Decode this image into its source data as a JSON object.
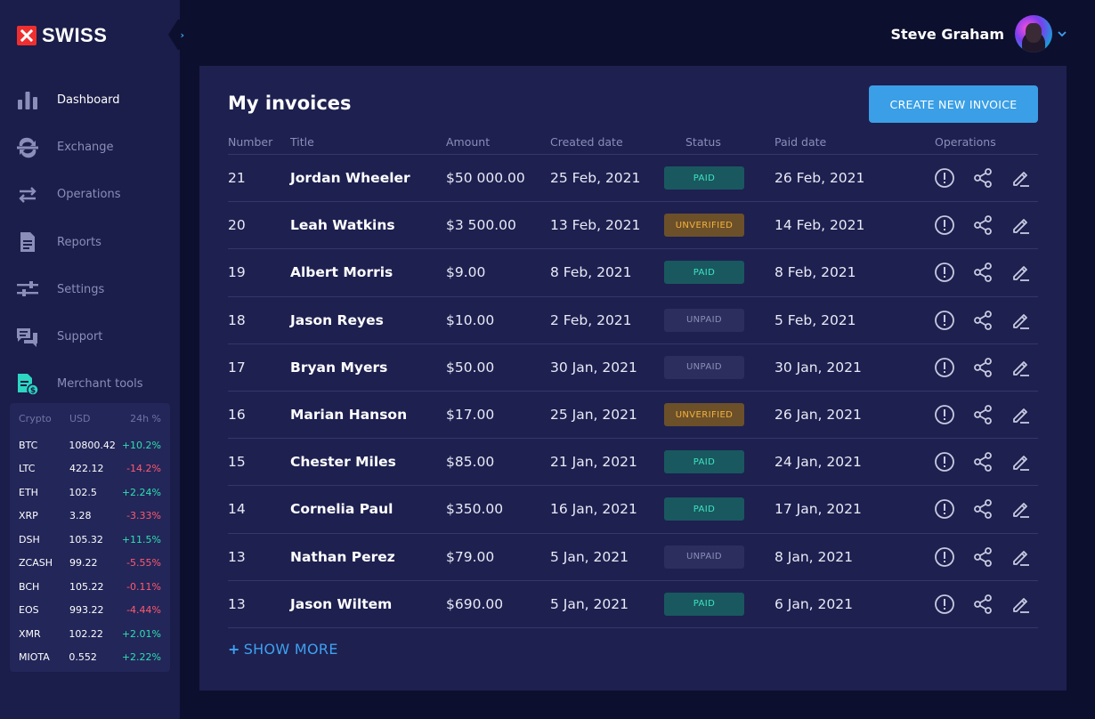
{
  "brand": {
    "name": "SWISS",
    "accent": "#3ea1f0",
    "logo_color": "#ef2f2f"
  },
  "nav": [
    {
      "label": "Dashboard",
      "icon": "bar-chart-icon",
      "active": true
    },
    {
      "label": "Exchange",
      "icon": "exchange-icon",
      "active": false
    },
    {
      "label": "Operations",
      "icon": "transfer-arrows-icon",
      "active": false
    },
    {
      "label": "Reports",
      "icon": "document-icon",
      "active": false
    },
    {
      "label": "Settings",
      "icon": "sliders-icon",
      "active": false
    },
    {
      "label": "Support",
      "icon": "chat-icon",
      "active": false
    },
    {
      "label": "Merchant tools",
      "icon": "merchant-document-icon",
      "active": false
    }
  ],
  "crypto": {
    "headers": [
      "Crypto",
      "USD",
      "24h %"
    ],
    "rows": [
      {
        "symbol": "BTC",
        "usd": "10800.42",
        "change": "+10.2%"
      },
      {
        "symbol": "LTC",
        "usd": "422.12",
        "change": "-14.2%"
      },
      {
        "symbol": "ETH",
        "usd": "102.5",
        "change": "+2.24%"
      },
      {
        "symbol": "XRP",
        "usd": "3.28",
        "change": "-3.33%"
      },
      {
        "symbol": "DSH",
        "usd": "105.32",
        "change": "+11.5%"
      },
      {
        "symbol": "ZCASH",
        "usd": "99.22",
        "change": "-5.55%"
      },
      {
        "symbol": "BCH",
        "usd": "105.22",
        "change": "-0.11%"
      },
      {
        "symbol": "EOS",
        "usd": "993.22",
        "change": "-4.44%"
      },
      {
        "symbol": "XMR",
        "usd": "102.22",
        "change": "+2.01%"
      },
      {
        "symbol": "MIOTA",
        "usd": "0.552",
        "change": "+2.22%"
      }
    ]
  },
  "header": {
    "user_name": "Steve Graham"
  },
  "invoices": {
    "title": "My invoices",
    "create_label": "CREATE NEW INVOICE",
    "columns": [
      "Number",
      "Title",
      "Amount",
      "Created date",
      "Status",
      "Paid date",
      "Operations"
    ],
    "rows": [
      {
        "number": "21",
        "title": "Jordan Wheeler",
        "amount": "$50 000.00",
        "created": "25 Feb, 2021",
        "status": "PAID",
        "paid": "26 Feb, 2021"
      },
      {
        "number": "20",
        "title": "Leah Watkins",
        "amount": "$3 500.00",
        "created": "13 Feb, 2021",
        "status": "UNVERIFIED",
        "paid": "14 Feb, 2021"
      },
      {
        "number": "19",
        "title": "Albert Morris",
        "amount": "$9.00",
        "created": "8 Feb, 2021",
        "status": "PAID",
        "paid": "8 Feb, 2021"
      },
      {
        "number": "18",
        "title": "Jason Reyes",
        "amount": "$10.00",
        "created": "2 Feb, 2021",
        "status": "UNPAID",
        "paid": "5 Feb, 2021"
      },
      {
        "number": "17",
        "title": "Bryan Myers",
        "amount": "$50.00",
        "created": "30 Jan, 2021",
        "status": "UNPAID",
        "paid": "30 Jan, 2021"
      },
      {
        "number": "16",
        "title": "Marian Hanson",
        "amount": "$17.00",
        "created": "25 Jan, 2021",
        "status": "UNVERIFIED",
        "paid": "26 Jan, 2021"
      },
      {
        "number": "15",
        "title": "Chester Miles",
        "amount": "$85.00",
        "created": "21 Jan, 2021",
        "status": "PAID",
        "paid": "24 Jan, 2021"
      },
      {
        "number": "14",
        "title": "Cornelia Paul",
        "amount": "$350.00",
        "created": "16 Jan, 2021",
        "status": "PAID",
        "paid": "17 Jan, 2021"
      },
      {
        "number": "13",
        "title": "Nathan Perez",
        "amount": "$79.00",
        "created": "5 Jan, 2021",
        "status": "UNPAID",
        "paid": "8 Jan, 2021"
      },
      {
        "number": "13",
        "title": "Jason Wiltem",
        "amount": "$690.00",
        "created": "5 Jan, 2021",
        "status": "PAID",
        "paid": "6 Jan, 2021"
      }
    ],
    "show_more_label": "SHOW MORE"
  }
}
